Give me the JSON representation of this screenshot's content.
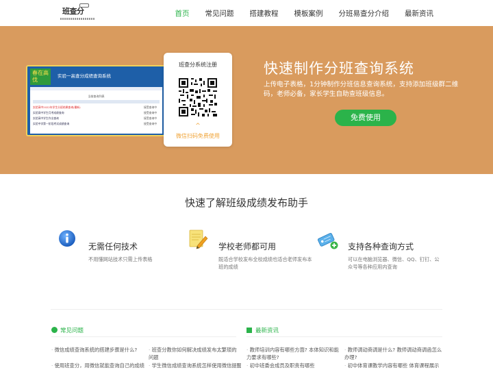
{
  "header": {
    "logo_text": "班查分",
    "nav": [
      "首页",
      "常见问题",
      "搭建教程",
      "模板案例",
      "分班易查分介绍",
      "最新资讯"
    ],
    "active_index": 0,
    "accent": "#2bb34a"
  },
  "hero": {
    "bg_color": "#d99b5e",
    "mock": {
      "logo_text": "春在高伐",
      "title": "实验一高查分成绩查询系统",
      "table_heading": "当前查询列表",
      "rows": [
        {
          "text": "实验高中2022年学生分班结果查询(最新)",
          "status": "接受查询中"
        },
        {
          "text": "实验高中学生月考成绩查询",
          "status": "接受查询中"
        },
        {
          "text": "实验高中学生作业查询",
          "status": "接受查询中"
        },
        {
          "text": "实验中学第一阶段考试成绩查询",
          "status": "接受查询中"
        }
      ]
    },
    "qr_card": {
      "title": "班查分系统注册",
      "chevron": "^",
      "label": "微信扫码免费使用"
    },
    "title": "快速制作分班查询系统",
    "description": "上传电子表格，1分钟制作分班信息查询系统，支持添加班级群二维码，老师必备，家长学生自助查班级信息。",
    "button_label": "免费使用"
  },
  "features": {
    "section_title": "快速了解班级成绩发布助手",
    "items": [
      {
        "icon": "info-icon",
        "title": "无需任何技术",
        "desc": "不用懂网站技术只需上传表格"
      },
      {
        "icon": "notepad-pencil-icon",
        "title": "学校老师都可用",
        "desc": "既适合学校发布全校成绩也适合老师发布本班的成绩"
      },
      {
        "icon": "tag-add-icon",
        "title": "支持各种查询方式",
        "desc": "可以在电脑浏览器、微信、QQ、钉钉、公众号等各种应用内查询"
      }
    ]
  },
  "faq": {
    "heading": "常见问题",
    "items": [
      "微信成绩查询系统的搭建步骤是什么?",
      "班查分教你如何解决成绩发布太繁琐的问题",
      "使用班查分，用微信就能查询自己的成绩",
      "学生微信成绩查询系统怎样使用微信提醒"
    ]
  },
  "news": {
    "heading": "最新资讯",
    "items": [
      "教师培训内容有哪些方面? 本体知识和能力要求有哪些?",
      "教师调动商调是什么? 教师调动商调函怎么办理?",
      "初中班委会成员及职责有哪些",
      "初中体育课教学内容有哪些 体育课程展示"
    ]
  }
}
